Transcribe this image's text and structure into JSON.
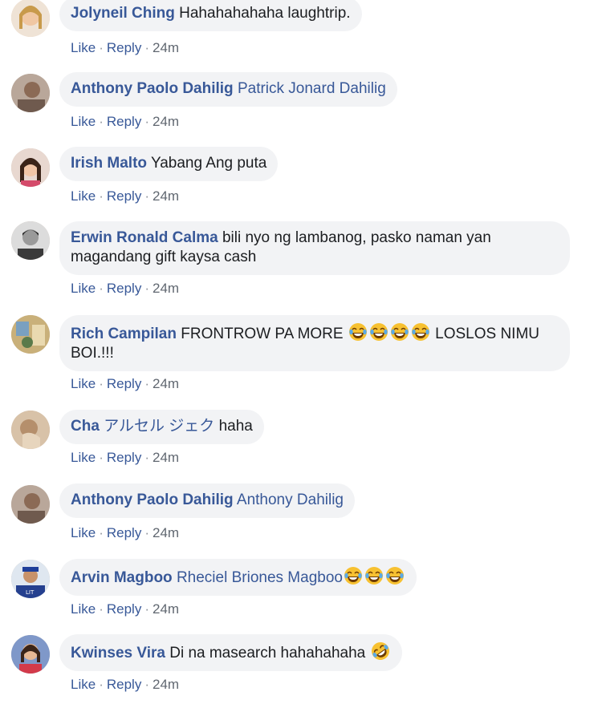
{
  "actions": {
    "like": "Like",
    "reply": "Reply",
    "time": "24m"
  },
  "comments": [
    {
      "author": "Jolyneil Ching",
      "text": "Hahahahahaha laughtrip."
    },
    {
      "author": "Anthony Paolo Dahilig",
      "tag": "Patrick Jonard Dahilig"
    },
    {
      "author": "Irish Malto",
      "text": "Yabang Ang puta"
    },
    {
      "author": "Erwin Ronald Calma",
      "text": "bili nyo ng lambanog, pasko naman yan magandang gift kaysa cash"
    },
    {
      "author": "Rich Campilan",
      "text_pre": "FRONTROW PA MORE",
      "text_post": "LOSLOS NIMU BOI.!!!"
    },
    {
      "author": "Cha",
      "tag": "アルセル ジェク",
      "text": "haha"
    },
    {
      "author": "Anthony Paolo Dahilig",
      "tag": "Anthony Dahilig"
    },
    {
      "author": "Arvin Magboo",
      "tag": "Rheciel Briones Magboo"
    },
    {
      "author": "Kwinses Vira",
      "text": "Di na masearch hahahahaha"
    }
  ],
  "emoji": {
    "laugh_cry": "face-with-tears-of-joy-icon",
    "rofl": "rolling-on-floor-laughing-icon"
  }
}
